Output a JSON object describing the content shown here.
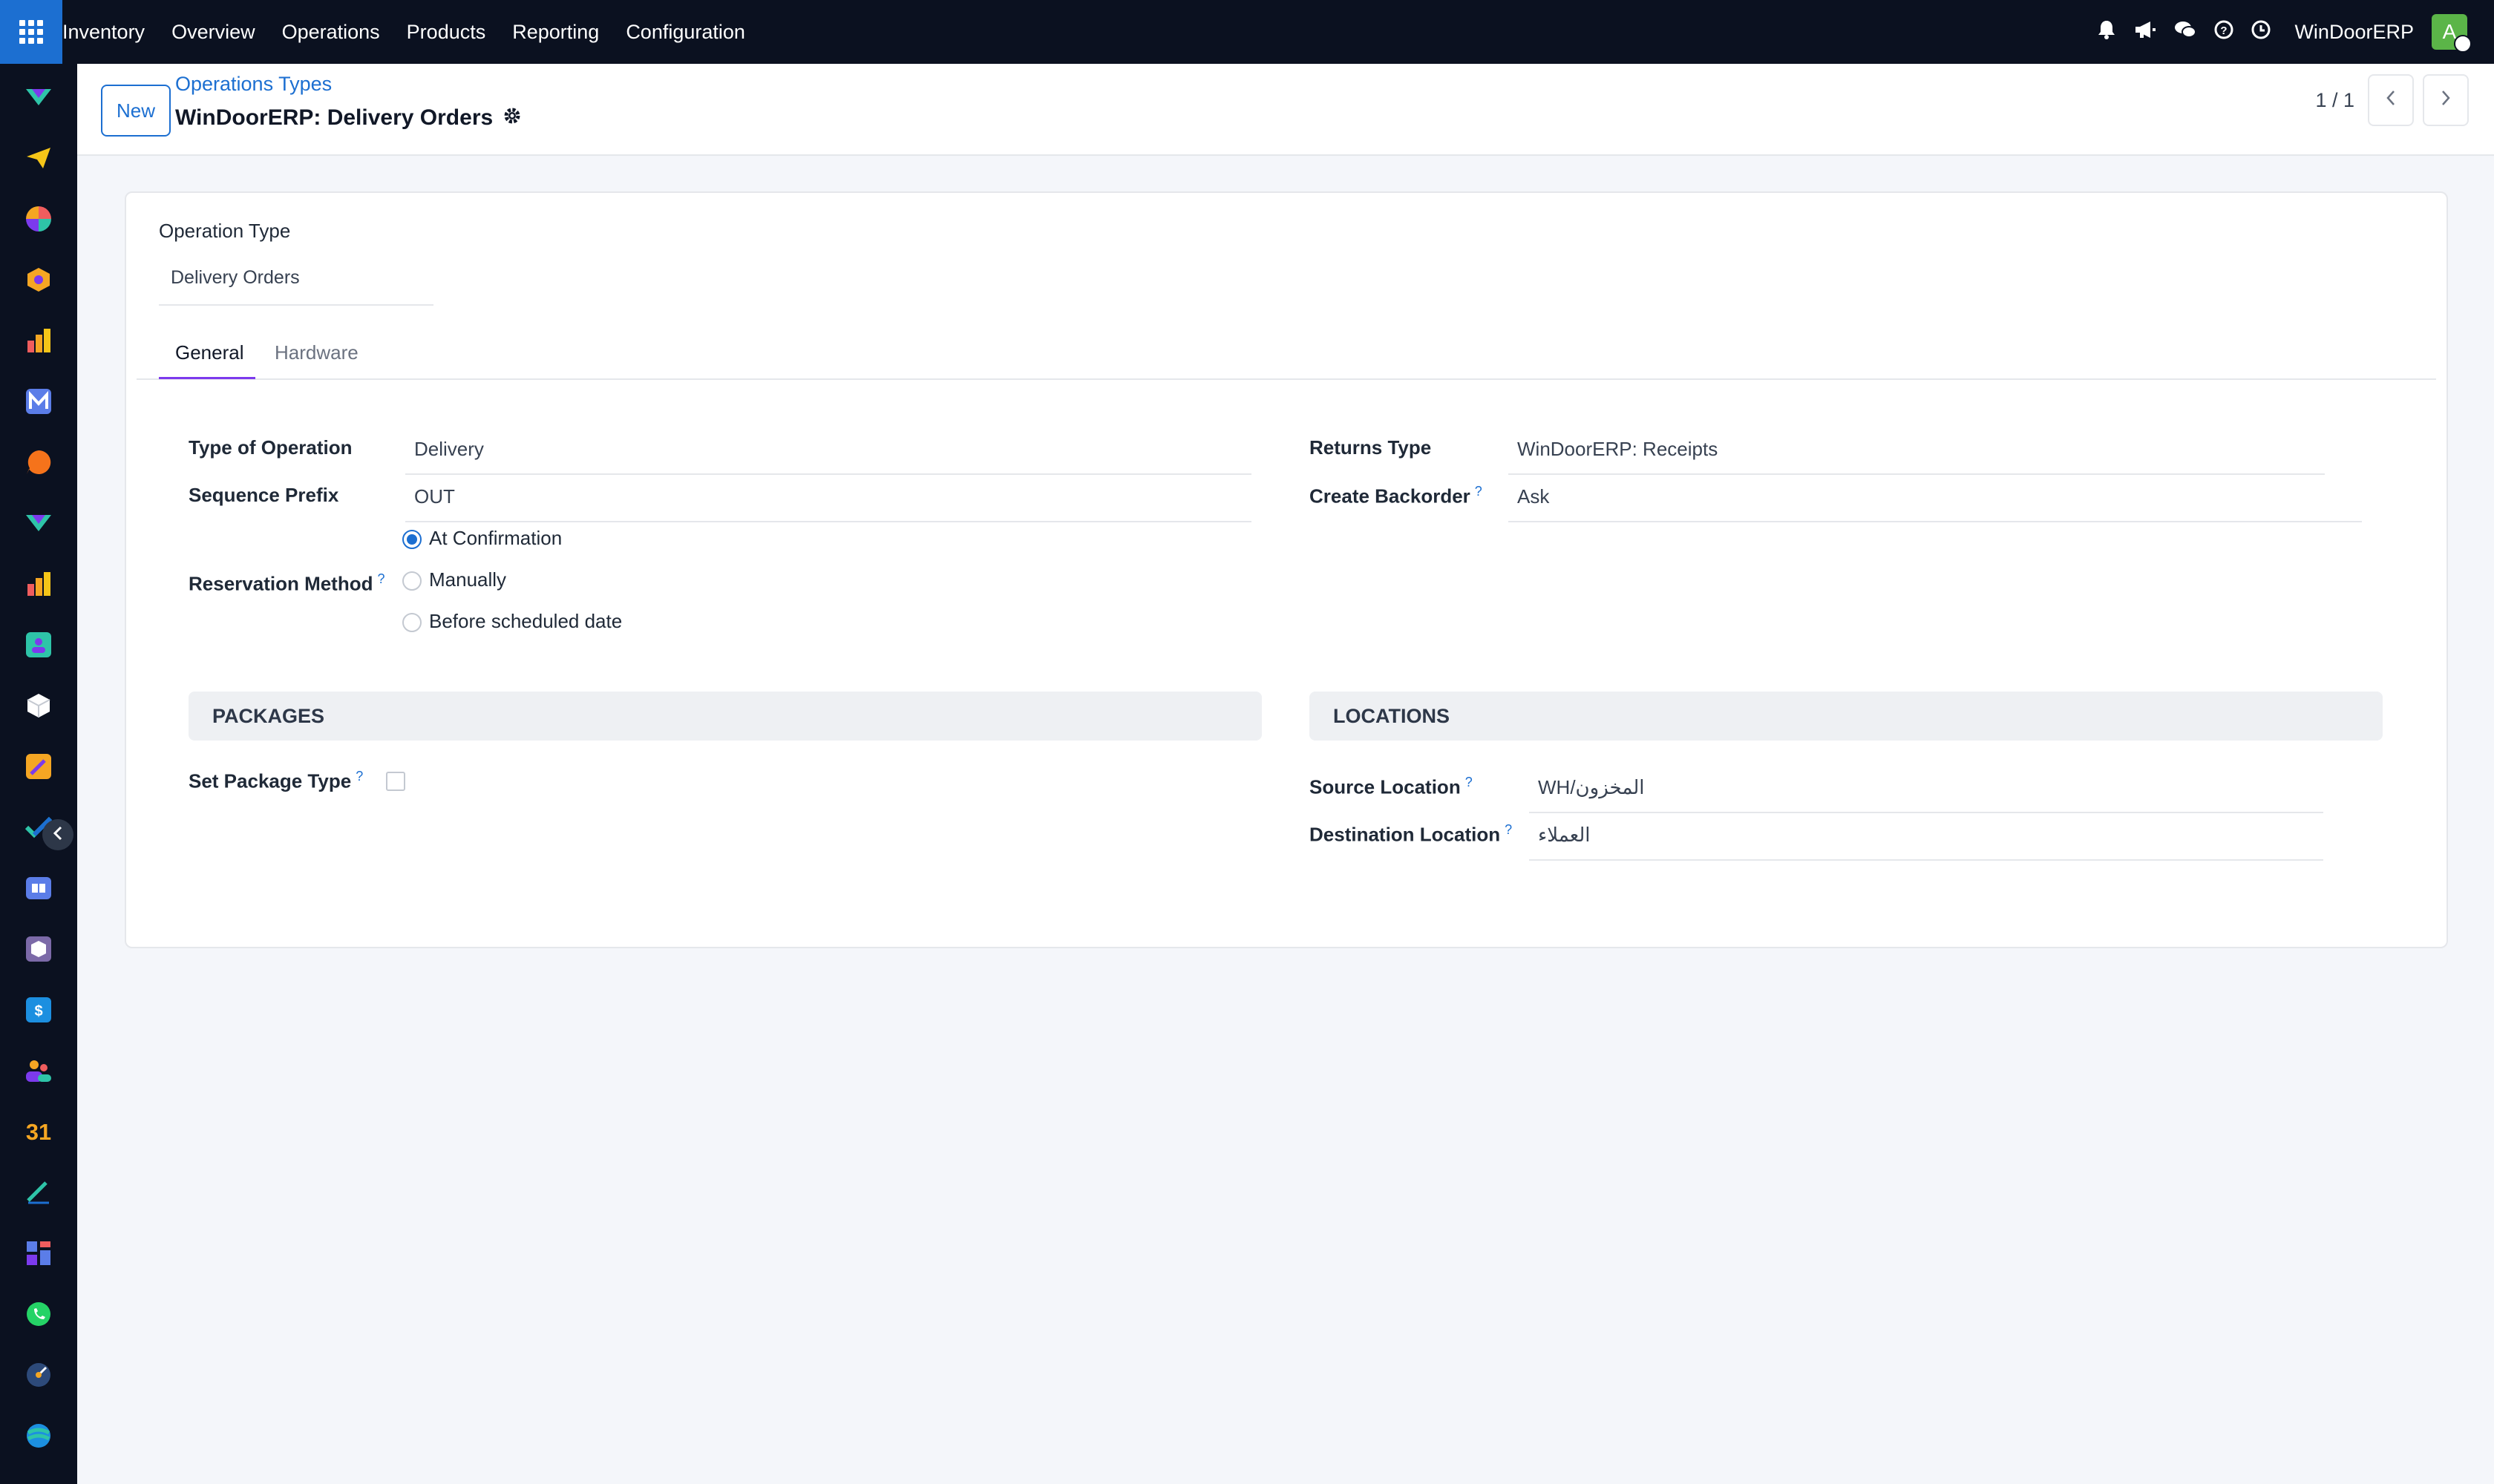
{
  "navbar": {
    "menu": [
      "Inventory",
      "Overview",
      "Operations",
      "Products",
      "Reporting",
      "Configuration"
    ],
    "company": "WinDoorERP",
    "avatar_letter": "A",
    "icons": [
      "bell-icon",
      "megaphone-icon",
      "chat-icon",
      "help-icon",
      "clock-icon"
    ]
  },
  "sidebar": {
    "icons": [
      "app-icon-1",
      "app-icon-2",
      "app-icon-3",
      "app-icon-4",
      "app-icon-5",
      "app-icon-6",
      "app-icon-7",
      "app-icon-8",
      "app-icon-9",
      "app-icon-10",
      "app-icon-11",
      "app-icon-12",
      "app-icon-13",
      "app-icon-14",
      "app-icon-15",
      "app-icon-16",
      "app-icon-17",
      "app-icon-18",
      "app-icon-19",
      "app-icon-20",
      "app-icon-21",
      "app-icon-22",
      "app-icon-23"
    ],
    "calendar_day": "31"
  },
  "control": {
    "new_label": "New",
    "breadcrumb": "Operations Types",
    "title": "WinDoorERP: Delivery Orders",
    "pager": "1 / 1"
  },
  "form": {
    "operation_type_label": "Operation Type",
    "operation_type_value": "Delivery Orders",
    "tabs": [
      "General",
      "Hardware"
    ],
    "type_of_operation_label": "Type of Operation",
    "type_of_operation_value": "Delivery",
    "sequence_prefix_label": "Sequence Prefix",
    "sequence_prefix_value": "OUT",
    "reservation_method_label": "Reservation Method",
    "reservation_options": [
      "At Confirmation",
      "Manually",
      "Before scheduled date"
    ],
    "reservation_selected": "At Confirmation",
    "returns_type_label": "Returns Type",
    "returns_type_value": "WinDoorERP: Receipts",
    "create_backorder_label": "Create Backorder",
    "create_backorder_value": "Ask",
    "packages_header": "PACKAGES",
    "set_package_type_label": "Set Package Type",
    "locations_header": "LOCATIONS",
    "source_location_label": "Source Location",
    "source_location_value": "WH/المخزون",
    "destination_location_label": "Destination Location",
    "destination_location_value": "العملاء",
    "help_mark": "?"
  }
}
